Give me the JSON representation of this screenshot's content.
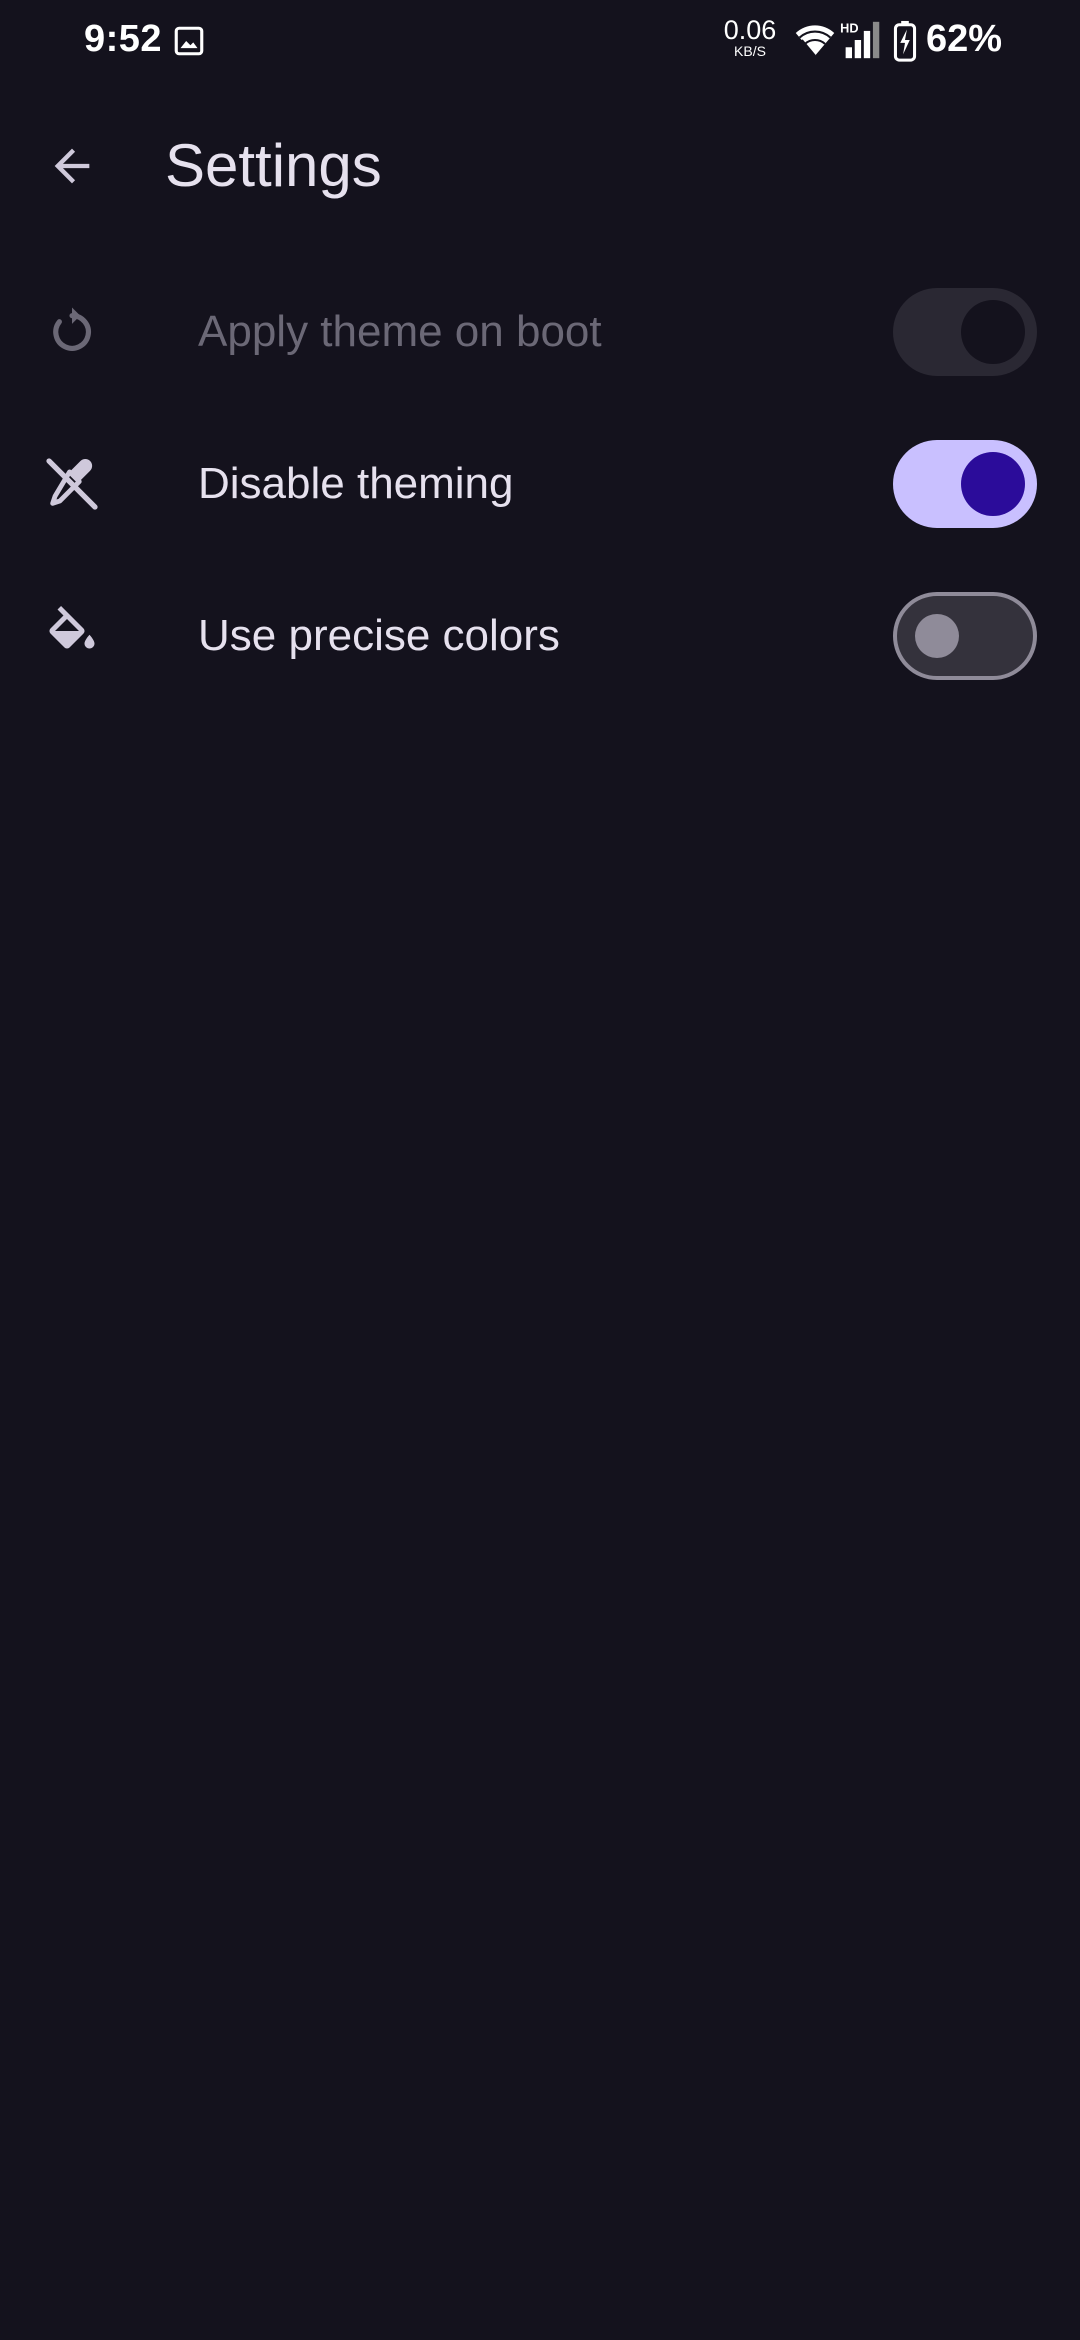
{
  "status_bar": {
    "time": "9:52",
    "net_speed_value": "0.06",
    "net_speed_unit": "KB/S",
    "network_badge": "HD",
    "battery_percent": "62%"
  },
  "app_bar": {
    "title": "Settings",
    "back_icon": "arrow-back-icon"
  },
  "settings": [
    {
      "label": "Apply theme on boot",
      "icon": "refresh-icon",
      "enabled": false,
      "checked": true
    },
    {
      "label": "Disable theming",
      "icon": "format-color-reset-icon",
      "enabled": true,
      "checked": true
    },
    {
      "label": "Use precise colors",
      "icon": "format-color-fill-icon",
      "enabled": true,
      "checked": false
    }
  ],
  "colors": {
    "background": "#14121d",
    "switch_on_track": "#c9c0ff",
    "switch_on_thumb": "#2b0c9a",
    "text_primary": "#e6e1ee",
    "text_disabled": "#6b6876"
  }
}
